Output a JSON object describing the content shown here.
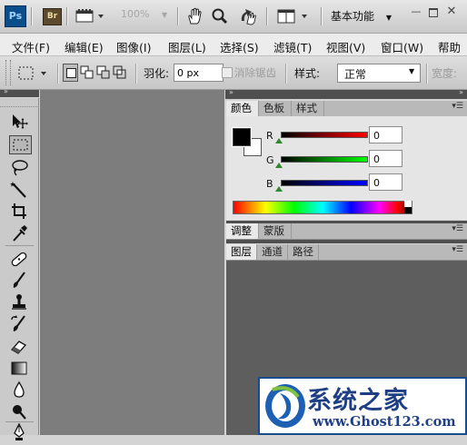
{
  "titlebar": {
    "app_logo": "Ps",
    "bridge_logo": "Br",
    "zoom": "100%",
    "workspace": "基本功能",
    "icons": [
      "screen-mode-icon",
      "hand-icon",
      "zoom-icon",
      "rotate-view-icon",
      "arrange-documents-icon"
    ]
  },
  "menubar": {
    "items": [
      "文件(F)",
      "编辑(E)",
      "图像(I)",
      "图层(L)",
      "选择(S)",
      "滤镜(T)",
      "视图(V)",
      "窗口(W)",
      "帮助"
    ]
  },
  "options": {
    "feather_label": "羽化:",
    "feather_value": "0 px",
    "antialias_label": "消除锯齿",
    "style_label": "样式:",
    "style_value": "正常",
    "width_label": "宽度:"
  },
  "tools": [
    "move-tool",
    "marquee-tool",
    "lasso-tool",
    "magic-wand-tool",
    "crop-tool",
    "eyedropper-tool",
    "spot-healing-tool",
    "brush-tool",
    "clone-stamp-tool",
    "history-brush-tool",
    "eraser-tool",
    "gradient-tool",
    "blur-tool",
    "dodge-tool",
    "pen-tool"
  ],
  "color_panel": {
    "tabs": [
      "颜色",
      "色板",
      "样式"
    ],
    "foreground": "#000000",
    "background": "#ffffff",
    "channels": [
      {
        "label": "R",
        "value": "0"
      },
      {
        "label": "G",
        "value": "0"
      },
      {
        "label": "B",
        "value": "0"
      }
    ]
  },
  "adjust_panel": {
    "tabs": [
      "调整",
      "蒙版"
    ]
  },
  "layers_panel": {
    "tabs": [
      "图层",
      "通道",
      "路径"
    ]
  },
  "watermark": {
    "title": "系统之家",
    "url": "www.Ghost123.com"
  }
}
